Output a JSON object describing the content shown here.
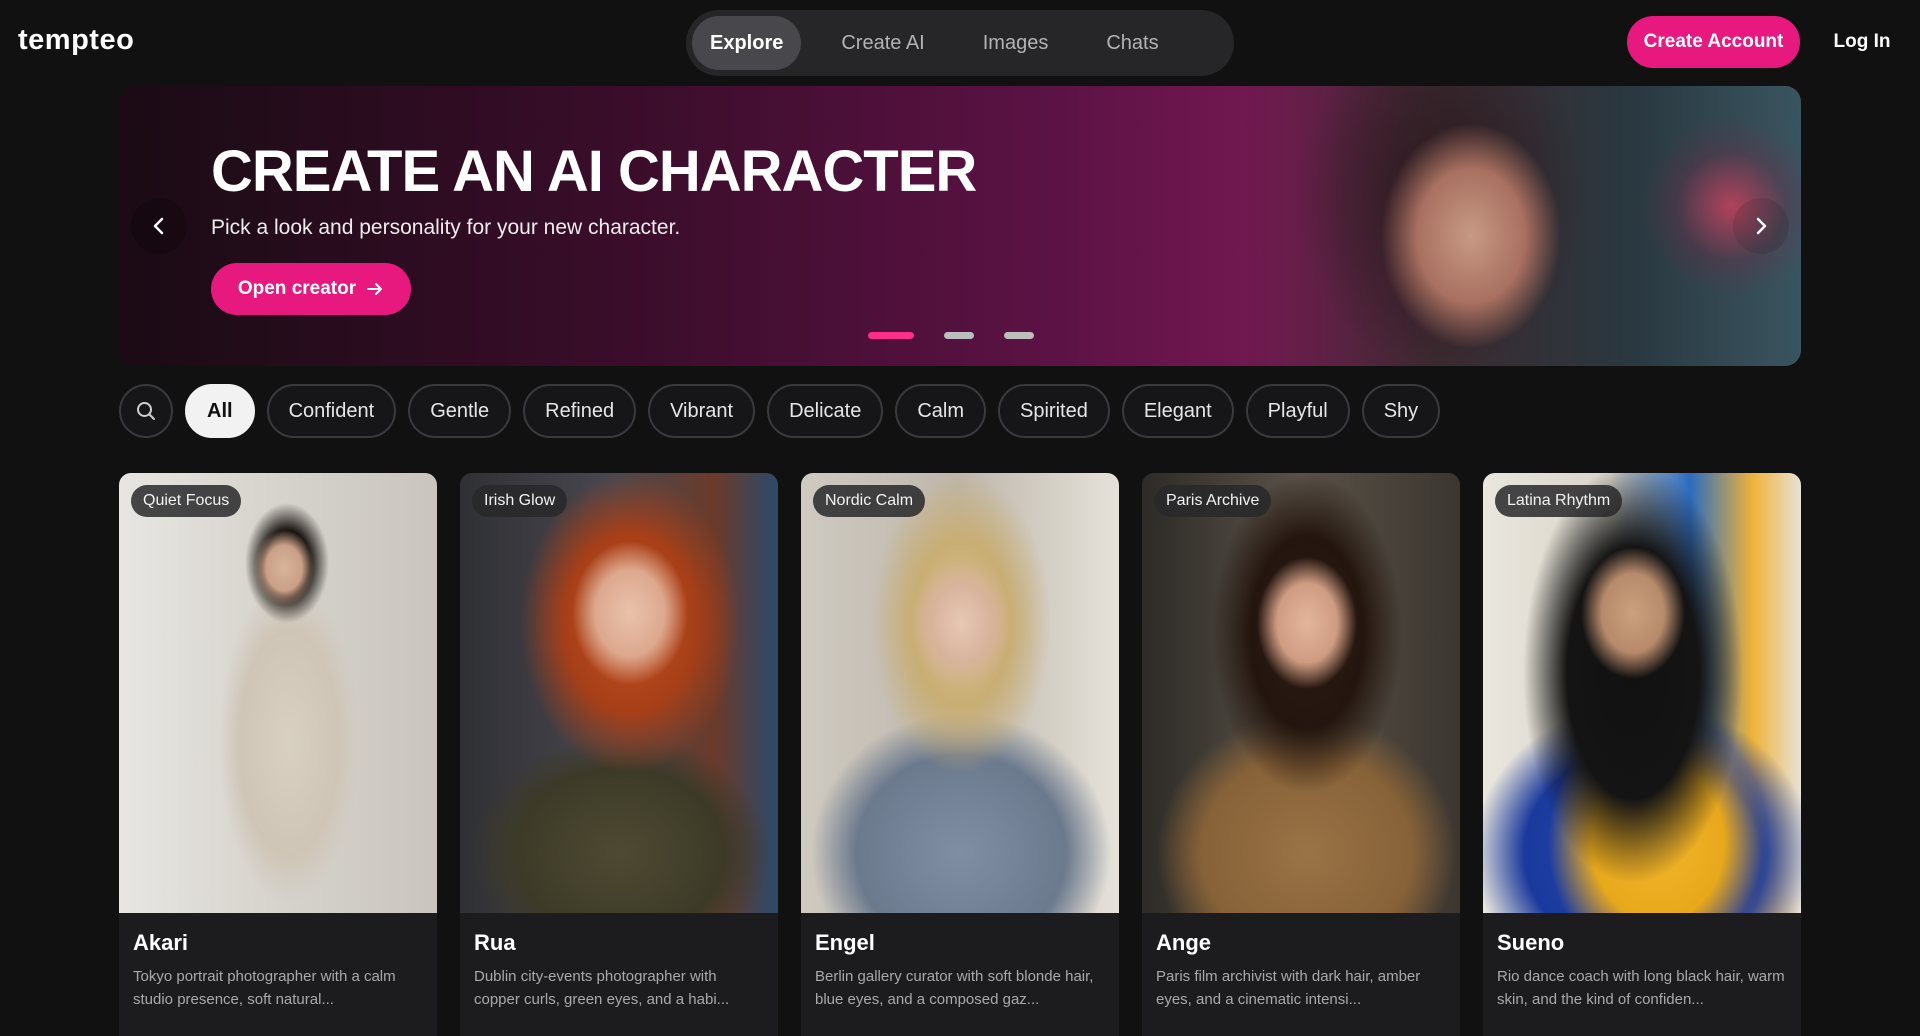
{
  "header": {
    "logo": "tempteo",
    "nav": [
      {
        "label": "Explore",
        "active": true
      },
      {
        "label": "Create AI",
        "active": false
      },
      {
        "label": "Images",
        "active": false
      },
      {
        "label": "Chats",
        "active": false
      }
    ],
    "create_account": "Create Account",
    "log_in": "Log In"
  },
  "hero": {
    "title": "CREATE AN AI CHARACTER",
    "subtitle": "Pick a look and personality for your new character.",
    "button": "Open creator",
    "button_icon": "arrow-right-icon",
    "prev_icon": "chevron-left-icon",
    "next_icon": "chevron-right-icon",
    "slides": 3,
    "active_slide": 1
  },
  "filters": {
    "search_icon": "search-icon",
    "chips": [
      "All",
      "Confident",
      "Gentle",
      "Refined",
      "Vibrant",
      "Delicate",
      "Calm",
      "Spirited",
      "Elegant",
      "Playful",
      "Shy"
    ],
    "active": "All"
  },
  "cards": [
    {
      "tag": "Quiet Focus",
      "name": "Akari",
      "desc": "Tokyo portrait photographer with a calm studio presence, soft natural..."
    },
    {
      "tag": "Irish Glow",
      "name": "Rua",
      "desc": "Dublin city-events photographer with copper curls, green eyes, and a habi..."
    },
    {
      "tag": "Nordic Calm",
      "name": "Engel",
      "desc": "Berlin gallery curator with soft blonde hair, blue eyes, and a composed gaz..."
    },
    {
      "tag": "Paris Archive",
      "name": "Ange",
      "desc": "Paris film archivist with dark hair, amber eyes, and a cinematic intensi..."
    },
    {
      "tag": "Latina Rhythm",
      "name": "Sueno",
      "desc": "Rio dance coach with long black hair, warm skin, and the kind of confiden..."
    }
  ],
  "colors": {
    "accent": "#e8197e",
    "background": "#111112",
    "dot_active": "#ff2d8a"
  }
}
